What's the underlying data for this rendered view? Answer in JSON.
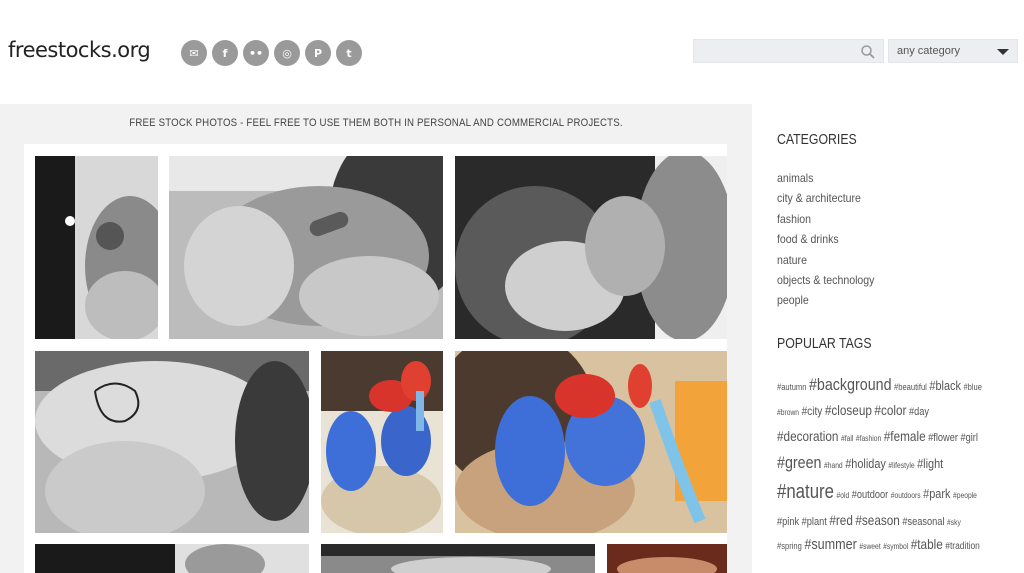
{
  "header": {
    "logo": "freestocks.org",
    "social": [
      {
        "name": "mail",
        "glyph": "✉"
      },
      {
        "name": "facebook",
        "glyph": "f"
      },
      {
        "name": "flickr",
        "glyph": "••"
      },
      {
        "name": "instagram",
        "glyph": "◎"
      },
      {
        "name": "pinterest",
        "glyph": "P"
      },
      {
        "name": "twitter",
        "glyph": "t"
      }
    ],
    "search_placeholder": "",
    "category_select": "any category"
  },
  "main": {
    "tagline": "FREE STOCK PHOTOS - FEEL FREE TO USE THEM BOTH IN PERSONAL AND COMMERCIAL PROJECTS."
  },
  "sidebar": {
    "categories_title": "CATEGORIES",
    "categories": [
      "animals",
      "city & architecture",
      "fashion",
      "food & drinks",
      "nature",
      "objects & technology",
      "people"
    ],
    "tags_title": "POPULAR TAGS",
    "tag_rows": [
      [
        {
          "t": "#autumn",
          "s": 9
        },
        {
          "t": "#background",
          "s": 17
        },
        {
          "t": "#beautiful",
          "s": 9
        },
        {
          "t": "#black",
          "s": 13
        },
        {
          "t": "#blue",
          "s": 9
        }
      ],
      [
        {
          "t": "#brown",
          "s": 8
        },
        {
          "t": "#city",
          "s": 12
        },
        {
          "t": "#closeup",
          "s": 14
        },
        {
          "t": "#color",
          "s": 14
        },
        {
          "t": "#day",
          "s": 11
        }
      ],
      [
        {
          "t": "#decoration",
          "s": 14
        },
        {
          "t": "#fall",
          "s": 8
        },
        {
          "t": "#fashion",
          "s": 8
        },
        {
          "t": "#female",
          "s": 14
        },
        {
          "t": "#flower",
          "s": 11
        },
        {
          "t": "#girl",
          "s": 11
        }
      ],
      [
        {
          "t": "#green",
          "s": 17
        },
        {
          "t": "#hand",
          "s": 8
        },
        {
          "t": "#holiday",
          "s": 13
        },
        {
          "t": "#lifestyle",
          "s": 8
        },
        {
          "t": "#light",
          "s": 13
        }
      ],
      [
        {
          "t": "#nature",
          "s": 20
        },
        {
          "t": "#old",
          "s": 8
        },
        {
          "t": "#outdoor",
          "s": 11
        },
        {
          "t": "#outdoors",
          "s": 8
        },
        {
          "t": "#park",
          "s": 13
        },
        {
          "t": "#people",
          "s": 8
        }
      ],
      [
        {
          "t": "#pink",
          "s": 11
        },
        {
          "t": "#plant",
          "s": 11
        },
        {
          "t": "#red",
          "s": 14
        },
        {
          "t": "#season",
          "s": 14
        },
        {
          "t": "#seasonal",
          "s": 11
        },
        {
          "t": "#sky",
          "s": 8
        }
      ],
      [
        {
          "t": "#spring",
          "s": 9
        },
        {
          "t": "#summer",
          "s": 15
        },
        {
          "t": "#sweet",
          "s": 8
        },
        {
          "t": "#symbol",
          "s": 8
        },
        {
          "t": "#table",
          "s": 14
        },
        {
          "t": "#tradition",
          "s": 10
        }
      ]
    ]
  }
}
